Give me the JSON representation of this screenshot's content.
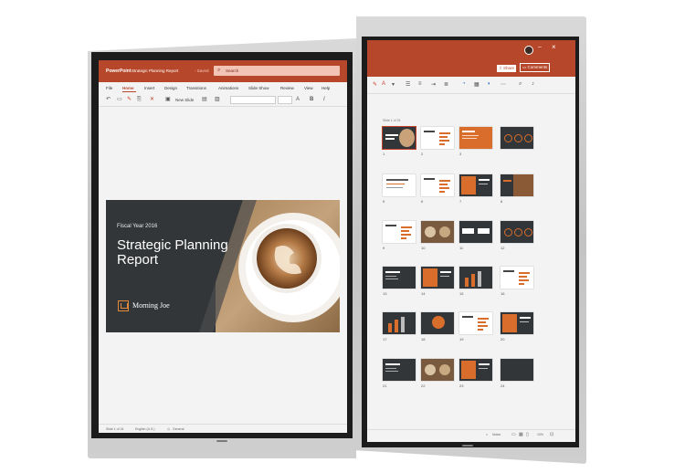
{
  "left_app": {
    "app_name": "PowerPoint",
    "doc_title": "Strategic Planning Report",
    "doc_saved": "- Saved",
    "search_placeholder": "Search",
    "tabs": [
      "File",
      "Home",
      "Insert",
      "Design",
      "Transitions",
      "Animations",
      "Slide Show",
      "Review",
      "View",
      "Help"
    ],
    "active_tab": "Home",
    "new_slide_label": "New Slide",
    "bold": "B",
    "italic": "I",
    "slide": {
      "subtitle": "Fiscal Year 2016",
      "title": "Strategic Planning Report",
      "brand": "Morning Joe"
    },
    "status": {
      "slide_of": "Slide 1 of 24",
      "language": "English (U.S.)",
      "sensitivity": "General"
    }
  },
  "right_app": {
    "share_label": "Share",
    "comments_label": "Comments",
    "slide_count": "Slide 1 of 24",
    "status_notes": "Notes",
    "status_zoom": "10%",
    "thumbs": [
      {
        "n": "1",
        "k": "title"
      },
      {
        "n": "2",
        "k": "white-bars"
      },
      {
        "n": "3",
        "k": "orange"
      },
      {
        "n": "",
        "k": "dark-circles"
      },
      {
        "n": "5",
        "k": "white-text"
      },
      {
        "n": "6",
        "k": "white-bars"
      },
      {
        "n": "7",
        "k": "orange-dark"
      },
      {
        "n": "8",
        "k": "photo"
      },
      {
        "n": "9",
        "k": "white-bars"
      },
      {
        "n": "10",
        "k": "photo-coffee"
      },
      {
        "n": "11",
        "k": "true-false"
      },
      {
        "n": "12",
        "k": "dark-circles"
      },
      {
        "n": "13",
        "k": "dark-text"
      },
      {
        "n": "14",
        "k": "orange-dark"
      },
      {
        "n": "15",
        "k": "dark-chart"
      },
      {
        "n": "16",
        "k": "white-bars"
      },
      {
        "n": "17",
        "k": "dark-chart"
      },
      {
        "n": "18",
        "k": "dark-pie"
      },
      {
        "n": "19",
        "k": "white-bars"
      },
      {
        "n": "20",
        "k": "orange-dark"
      },
      {
        "n": "21",
        "k": "dark-text"
      },
      {
        "n": "22",
        "k": "photo-coffee"
      },
      {
        "n": "23",
        "k": "orange-dark"
      },
      {
        "n": "24",
        "k": "dark-blank"
      }
    ],
    "tags": {
      "sel": "1",
      "badge": "12"
    }
  },
  "colors": {
    "accent": "#b7472a",
    "slide_dark": "#333638",
    "orange": "#d86d2c"
  }
}
